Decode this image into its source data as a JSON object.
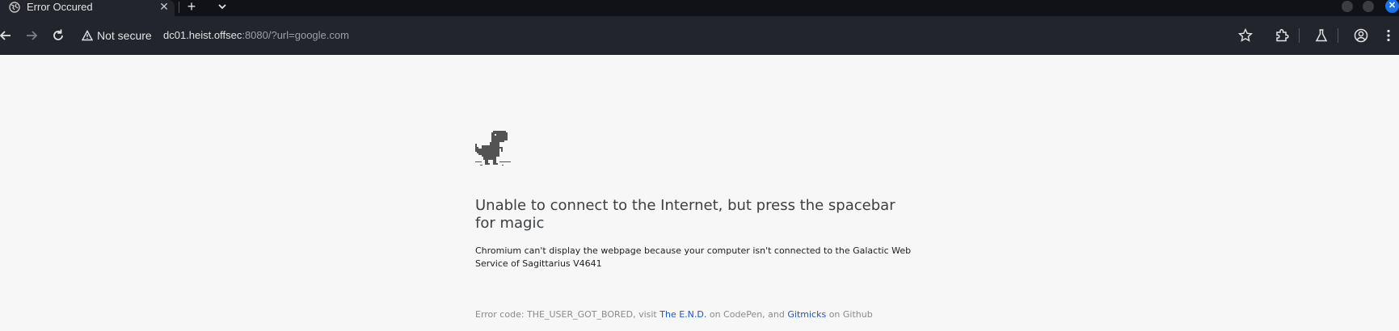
{
  "browser": {
    "tab": {
      "title": "Error Occured",
      "close": "✕"
    },
    "new_tab": "+",
    "security": {
      "label": "Not secure"
    },
    "url": {
      "host": "dc01.heist.offsec",
      "rest": ":8080/?url=google.com"
    },
    "colors": {
      "tabstrip": "#111217",
      "toolbar": "#23252c",
      "accent": "#1a73e8"
    }
  },
  "page": {
    "headline": "Unable to connect to the Internet, but press the spacebar for magic",
    "body": "Chromium can't display the webpage because your computer isn't connected to the Galactic Web Service of Sagittarius V4641",
    "error_prefix": "Error code: THE_USER_GOT_BORED, visit ",
    "link1": "The E.N.D.",
    "mid1": " on CodePen, and ",
    "link2": "Gitmicks",
    "suffix": " on Github",
    "link_color": "#1a56c8"
  }
}
